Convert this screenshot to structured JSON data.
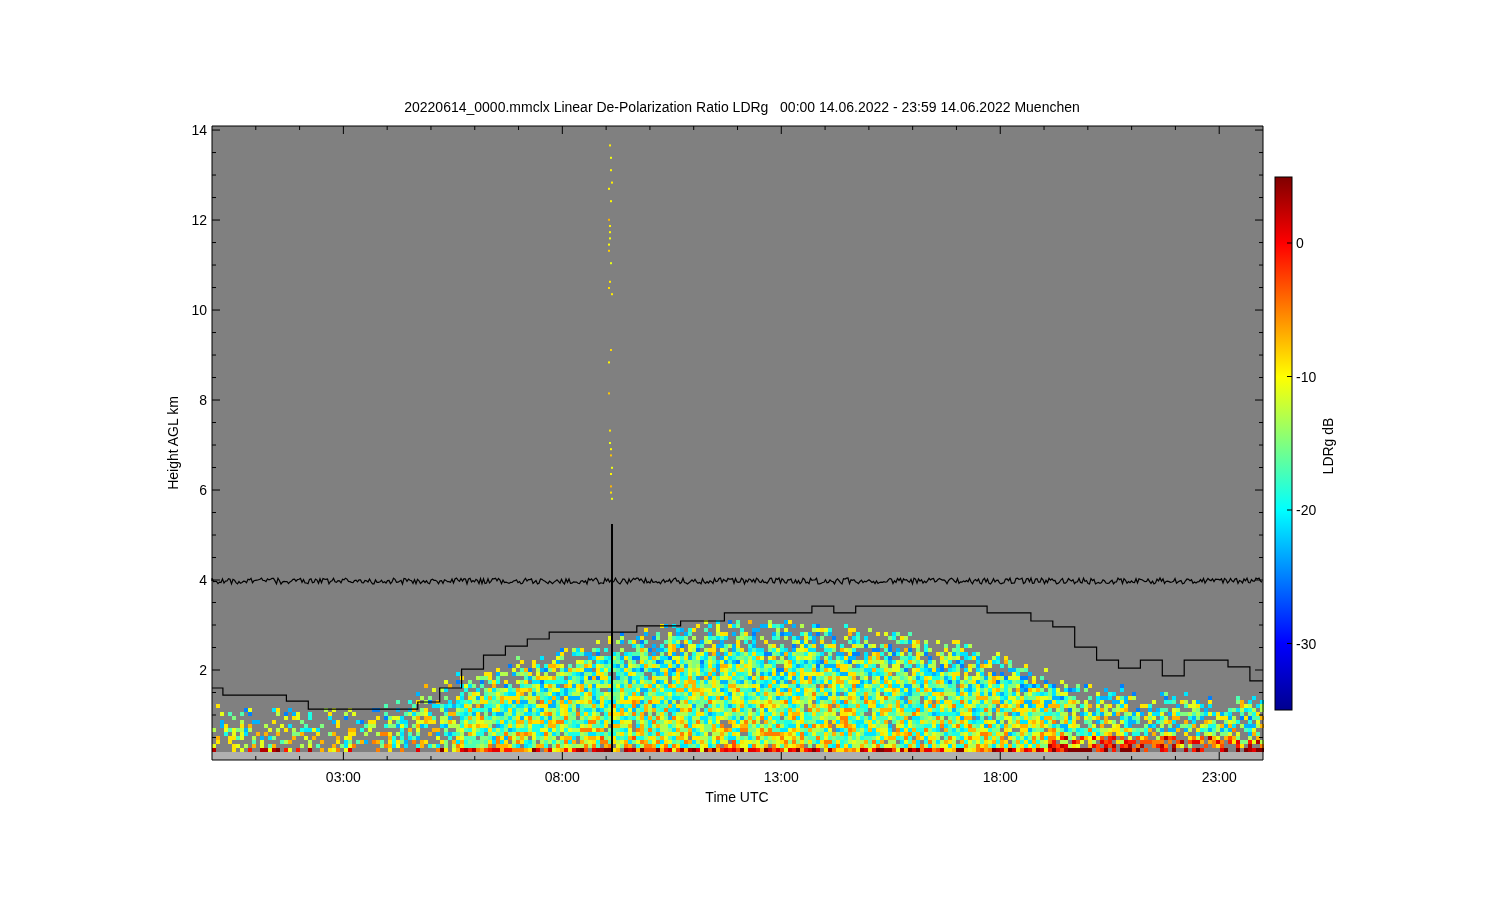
{
  "figure": {
    "title": "20220614_0000.mmclx Linear De-Polarization Ratio LDRg   00:00 14.06.2022 - 23:59 14.06.2022 Muenchen",
    "chart_data": {
      "type": "line",
      "xlabel": "Time UTC",
      "ylabel": "Height AGL km",
      "x": [
        0,
        0.25,
        0.25,
        1.7,
        1.7,
        2.2,
        2.2,
        4.7,
        4.7,
        5.2,
        5.2,
        5.7,
        5.7,
        6.2,
        6.2,
        6.7,
        6.7,
        7.2,
        7.2,
        7.7,
        7.7,
        9.7,
        9.7,
        10.7,
        10.7,
        11.7,
        11.7,
        13.7,
        13.7,
        14.2,
        14.2,
        14.7,
        14.7,
        17.7,
        17.7,
        18.7,
        18.7,
        19.2,
        19.2,
        19.7,
        19.7,
        20.2,
        20.2,
        20.7,
        20.7,
        21.2,
        21.2,
        21.7,
        21.7,
        22.2,
        22.2,
        23.2,
        23.2,
        23.7,
        23.7,
        24
      ],
      "series": [
        {
          "color": "#000000",
          "values": [
            1.6,
            1.6,
            1.44,
            1.44,
            1.31,
            1.31,
            1.13,
            1.13,
            1.29,
            1.29,
            1.6,
            1.6,
            2.02,
            2.02,
            2.33,
            2.33,
            2.53,
            2.53,
            2.69,
            2.69,
            2.84,
            2.84,
            2.98,
            2.98,
            3.09,
            3.09,
            3.27,
            3.27,
            3.42,
            3.42,
            3.27,
            3.27,
            3.42,
            3.42,
            3.27,
            3.27,
            3.09,
            3.09,
            2.96,
            2.96,
            2.51,
            2.51,
            2.22,
            2.22,
            2.04,
            2.04,
            2.22,
            2.22,
            1.87,
            1.87,
            2.22,
            2.22,
            2.07,
            2.07,
            1.76,
            1.76
          ]
        }
      ],
      "xlim": [
        0,
        24
      ],
      "ylim": [
        0,
        14.09
      ],
      "xticks": [
        {
          "value": 3,
          "label": "03:00"
        },
        {
          "value": 8,
          "label": "08:00"
        },
        {
          "value": 13,
          "label": "13:00"
        },
        {
          "value": 18,
          "label": "18:00"
        },
        {
          "value": 23,
          "label": "23:00"
        }
      ],
      "yticks": [
        2,
        4,
        6,
        8,
        10,
        12,
        14
      ]
    },
    "colorbar": {
      "label": "LDRg dB",
      "ticks": [
        "0",
        "-10",
        "-20",
        "-30"
      ]
    }
  }
}
